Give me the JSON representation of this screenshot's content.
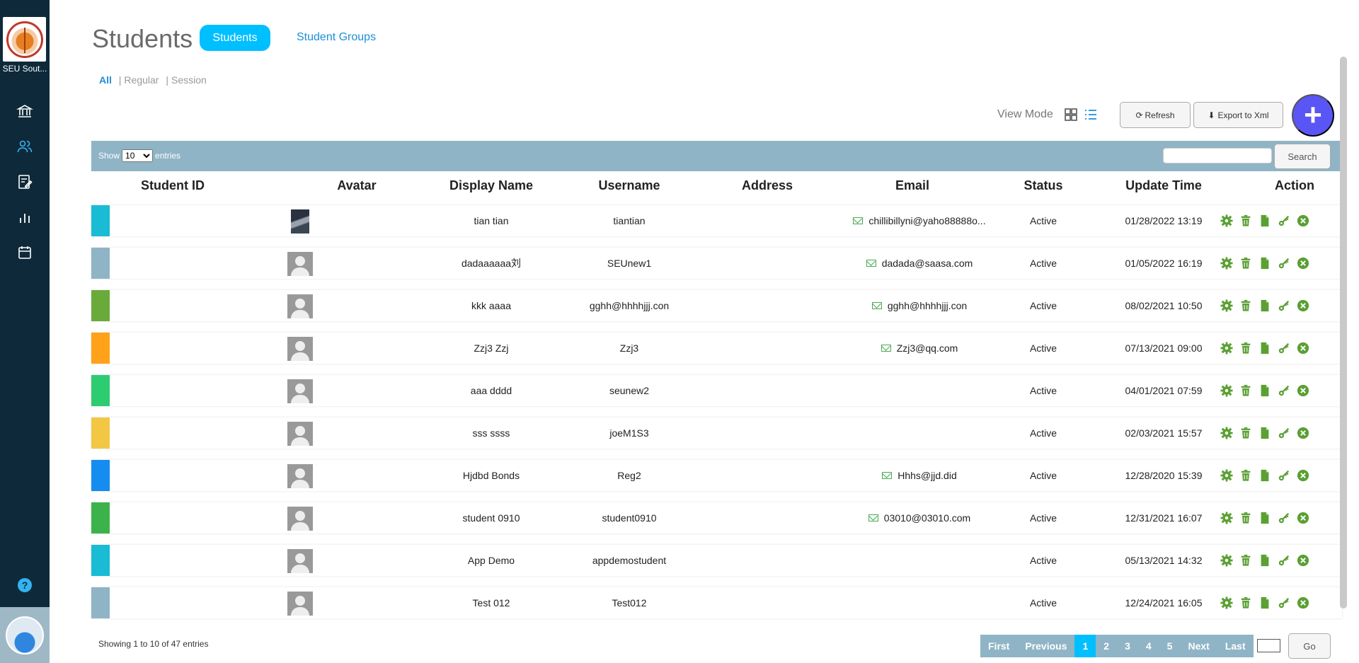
{
  "sidebar": {
    "org_name": "SEU Sout...",
    "nav": [
      {
        "icon": "bank-icon"
      },
      {
        "icon": "users-icon"
      },
      {
        "icon": "edit-form-icon"
      },
      {
        "icon": "bar-chart-icon"
      },
      {
        "icon": "calendar-icon"
      }
    ],
    "help_label": "?"
  },
  "header": {
    "title": "Students",
    "tab_students": "Students",
    "tab_groups": "Student Groups"
  },
  "filter": {
    "all": "All",
    "regular": "Regular",
    "session": "Session",
    "sep": "|"
  },
  "toolbar": {
    "view_mode_label": "View Mode",
    "refresh_label": "Refresh",
    "export_label": "Export to Xml",
    "add_label": "+",
    "refresh_glyph": "⟳",
    "export_glyph": "⬇"
  },
  "table_controls": {
    "show_label": "Show",
    "entries_label": "entries",
    "page_size": "10",
    "search_label": "Search"
  },
  "columns": [
    "Student ID",
    "Avatar",
    "Display Name",
    "Username",
    "Address",
    "Email",
    "Status",
    "Update Time",
    "Action"
  ],
  "rows": [
    {
      "color": "#19bcd4",
      "avatar": "photo",
      "display_name": "tian tian",
      "username": "tiantian",
      "email": "chillibillyni@yaho88888o...",
      "status": "Active",
      "updated": "01/28/2022 13:19"
    },
    {
      "color": "#8fb4c6",
      "avatar": "default",
      "display_name": "dadaaaaaa刘",
      "username": "SEUnew1",
      "email": "dadada@saasa.com",
      "status": "Active",
      "updated": "01/05/2022 16:19"
    },
    {
      "color": "#6aaa3a",
      "avatar": "default",
      "display_name": "kkk aaaa",
      "username": "gghh@hhhhjjj.con",
      "email": "gghh@hhhhjjj.con",
      "status": "Active",
      "updated": "08/02/2021 10:50"
    },
    {
      "color": "#ffa21a",
      "avatar": "default",
      "display_name": "Zzj3 Zzj",
      "username": "Zzj3",
      "email": "Zzj3@qq.com",
      "status": "Active",
      "updated": "07/13/2021 09:00"
    },
    {
      "color": "#2ecc71",
      "avatar": "default",
      "display_name": "aaa dddd",
      "username": "seunew2",
      "email": "",
      "status": "Active",
      "updated": "04/01/2021 07:59"
    },
    {
      "color": "#f2c744",
      "avatar": "default",
      "display_name": "sss ssss",
      "username": "joeM1S3",
      "email": "",
      "status": "Active",
      "updated": "02/03/2021 15:57"
    },
    {
      "color": "#158cf0",
      "avatar": "default",
      "display_name": "Hjdbd Bonds",
      "username": "Reg2",
      "email": "Hhhs@jjd.did",
      "status": "Active",
      "updated": "12/28/2020 15:39"
    },
    {
      "color": "#3cb34a",
      "avatar": "default",
      "display_name": "student 0910",
      "username": "student0910",
      "email": "03010@03010.com",
      "status": "Active",
      "updated": "12/31/2021 16:07"
    },
    {
      "color": "#19bcd4",
      "avatar": "default",
      "display_name": "App Demo",
      "username": "appdemostudent",
      "email": "",
      "status": "Active",
      "updated": "05/13/2021 14:32"
    },
    {
      "color": "#8fb4c6",
      "avatar": "default",
      "display_name": "Test 012",
      "username": "Test012",
      "email": "",
      "status": "Active",
      "updated": "12/24/2021 16:05"
    }
  ],
  "action_icons": [
    "gear-icon",
    "trash-icon",
    "document-icon",
    "key-icon",
    "remove-icon"
  ],
  "footer": {
    "info": "Showing 1 to 10 of 47 entries",
    "pager": [
      "First",
      "Previous",
      "1",
      "2",
      "3",
      "4",
      "5",
      "Next",
      "Last"
    ],
    "active_page": "1",
    "go_label": "Go"
  },
  "colors": {
    "sidebar_bg": "#0e2a3a",
    "accent": "#00bfff",
    "toolbar_bg": "#8fb4c6",
    "fab": "#5a55f5",
    "action_green": "#5aa033"
  }
}
